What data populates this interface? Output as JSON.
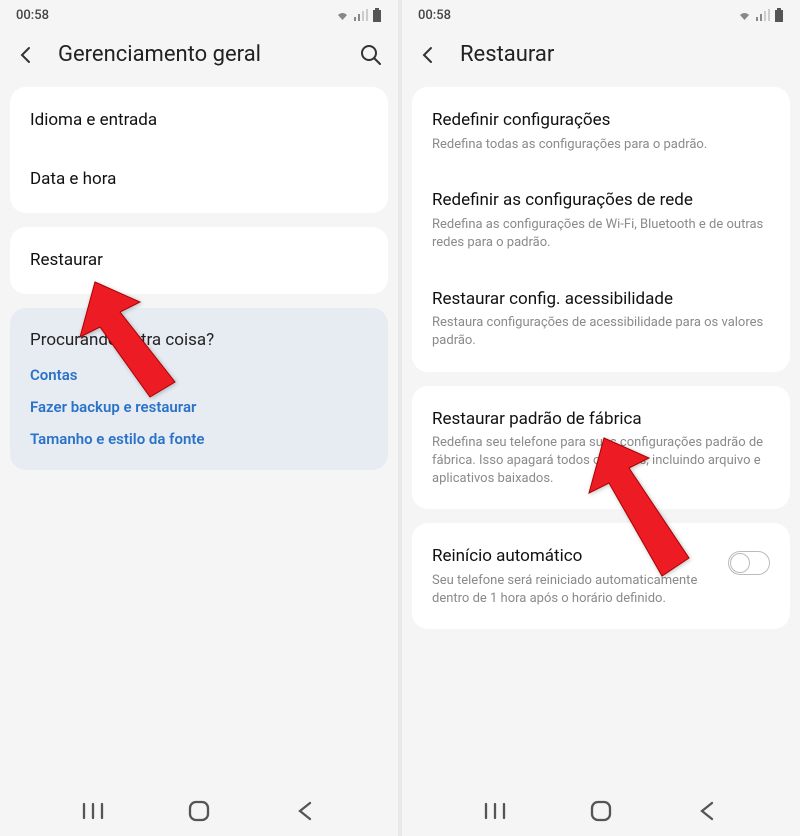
{
  "status": {
    "time": "00:58"
  },
  "colors": {
    "link": "#2b72c9",
    "arrow": "#ed1c24",
    "bg": "#f5f5f5",
    "card": "#ffffff"
  },
  "left": {
    "header_title": "Gerenciamento geral",
    "items": [
      {
        "title": "Idioma e entrada"
      },
      {
        "title": "Data e hora"
      }
    ],
    "restore": {
      "title": "Restaurar"
    },
    "discover": {
      "title": "Procurando outra coisa?",
      "links": [
        "Contas",
        "Fazer backup e restaurar",
        "Tamanho e estilo da fonte"
      ]
    }
  },
  "right": {
    "header_title": "Restaurar",
    "group1": [
      {
        "title": "Redefinir configurações",
        "sub": "Redefina todas as configurações para o padrão."
      },
      {
        "title": "Redefinir as configurações de rede",
        "sub": "Redefina as configurações de Wi-Fi, Bluetooth e de outras redes para o padrão."
      },
      {
        "title": "Restaurar config. acessibilidade",
        "sub": "Restaura configurações de acessibilidade para os valores padrão."
      }
    ],
    "group2": [
      {
        "title": "Restaurar padrão de fábrica",
        "sub": "Redefina seu telefone para suas configurações padrão de fábrica. Isso apagará todos os dados, incluindo arquivo e aplicativos baixados."
      }
    ],
    "group3": [
      {
        "title": "Reinício automático",
        "sub": "Seu telefone será reiniciado automaticamente dentro de 1 hora após o horário definido."
      }
    ]
  }
}
